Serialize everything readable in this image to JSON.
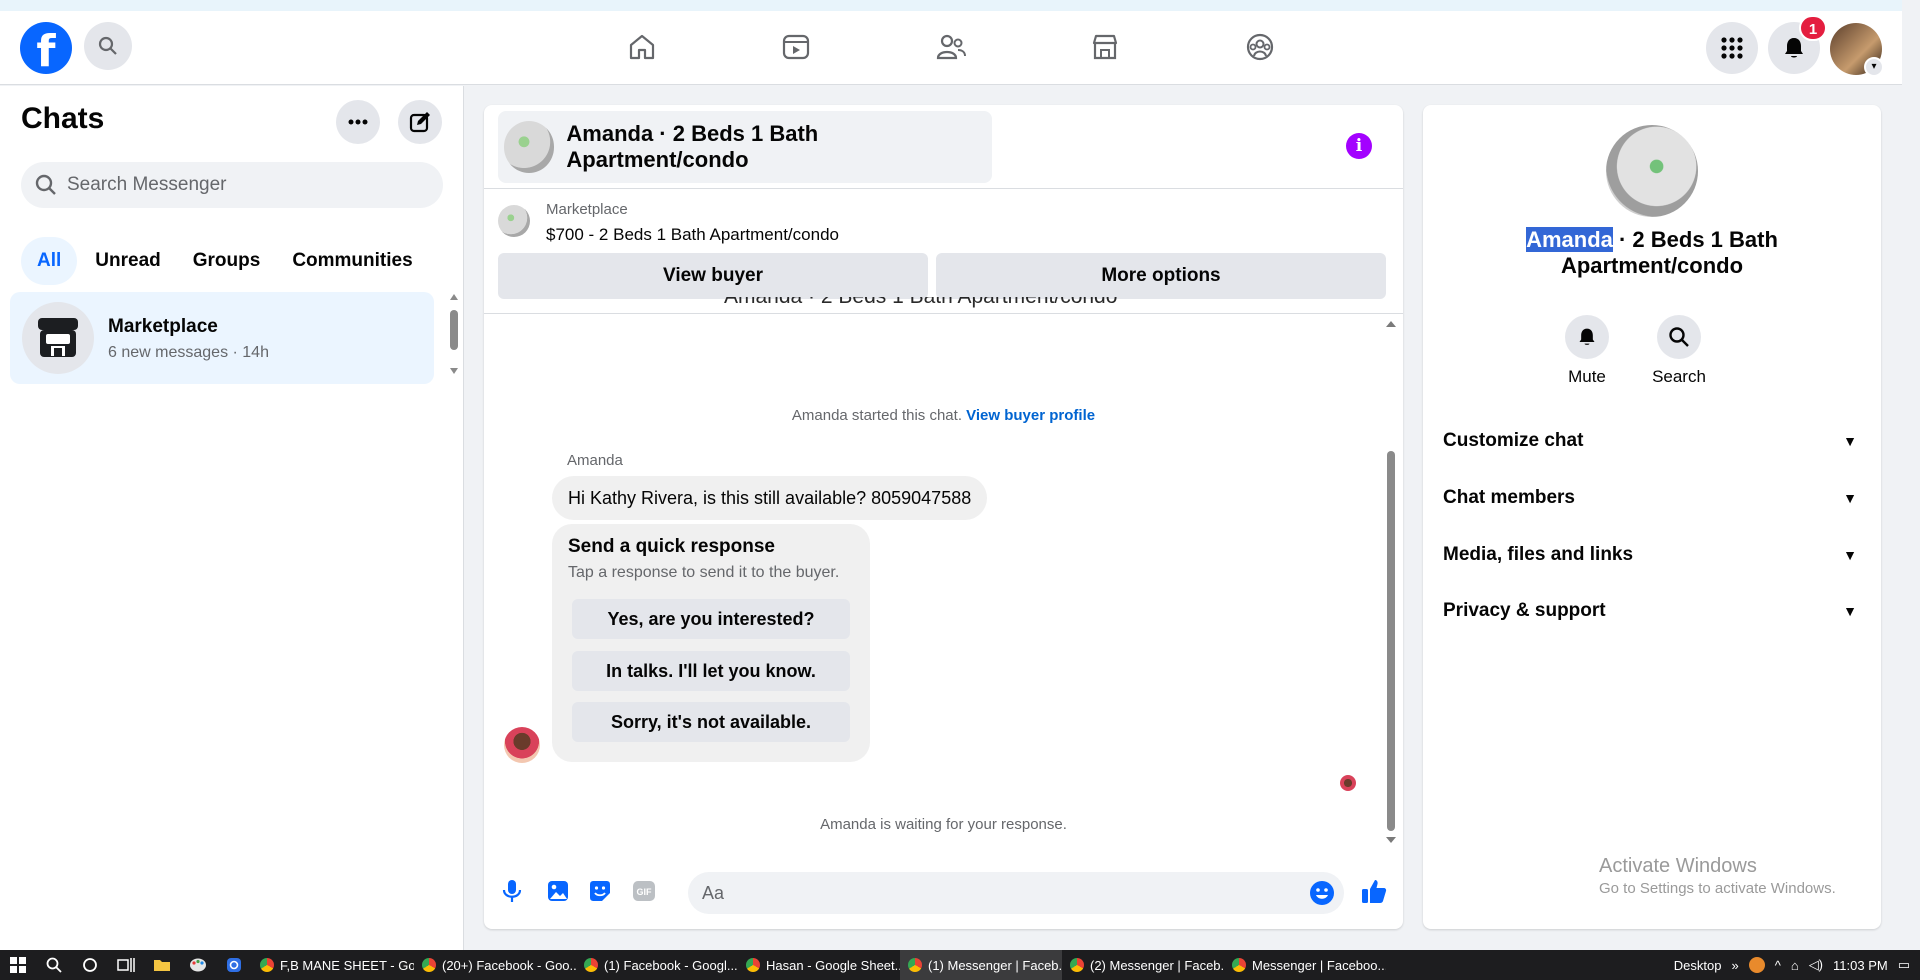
{
  "nav": {
    "logo": "f",
    "notification_count": "1"
  },
  "sidebar": {
    "title": "Chats",
    "search_placeholder": "Search Messenger",
    "filters": [
      "All",
      "Unread",
      "Groups",
      "Communities"
    ],
    "active_filter": "All",
    "conversation": {
      "name": "Marketplace",
      "subtitle": "6 new messages · 14h"
    }
  },
  "chat": {
    "header_title": "Amanda · 2 Beds 1 Bath Apartment/condo",
    "marketplace_label": "Marketplace",
    "listing": "$700 - 2 Beds 1 Bath Apartment/condo",
    "view_buyer": "View buyer",
    "more_options": "More options",
    "partial_title": "Amanda · 2 Beds 1 Bath Apartment/condo",
    "started_text": "Amanda started this chat.",
    "view_buyer_profile": "View buyer profile",
    "sender": "Amanda",
    "message": "Hi Kathy Rivera, is this still available? 8059047588",
    "quick_title": "Send a quick response",
    "quick_sub": "Tap a response to send it to the buyer.",
    "quick_options": [
      "Yes, are you interested?",
      "In talks. I'll let you know.",
      "Sorry, it's not available."
    ],
    "waiting": "Amanda is waiting for your response.",
    "input_placeholder": "Aa"
  },
  "details": {
    "title_selected": "Amanda",
    "title_rest": " · 2 Beds 1 Bath Apartment/condo",
    "actions": [
      "Mute",
      "Search"
    ],
    "rows": [
      "Customize chat",
      "Chat members",
      "Media, files and links",
      "Privacy & support"
    ],
    "activate_title": "Activate Windows",
    "activate_sub": "Go to Settings to activate Windows."
  },
  "taskbar": {
    "tasks": [
      "F,B MANE SHEET - Go...",
      "(20+) Facebook - Goo...",
      "(1) Facebook - Googl...",
      "Hasan - Google Sheet...",
      "(1) Messenger | Faceb...",
      "(2) Messenger | Faceb...",
      "Messenger | Faceboo..."
    ],
    "active_task_index": 4,
    "desktop": "Desktop",
    "time": "11:03 PM"
  },
  "colors": {
    "accent": "#0866ff",
    "info": "#a301ff",
    "badge": "#e41e3f"
  }
}
